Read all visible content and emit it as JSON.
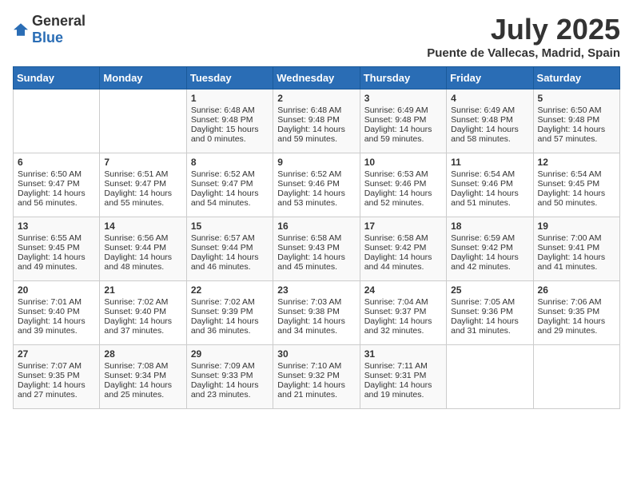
{
  "logo": {
    "general": "General",
    "blue": "Blue"
  },
  "header": {
    "month_year": "July 2025",
    "location": "Puente de Vallecas, Madrid, Spain"
  },
  "weekdays": [
    "Sunday",
    "Monday",
    "Tuesday",
    "Wednesday",
    "Thursday",
    "Friday",
    "Saturday"
  ],
  "weeks": [
    [
      {
        "day": "",
        "sunrise": "",
        "sunset": "",
        "daylight": ""
      },
      {
        "day": "",
        "sunrise": "",
        "sunset": "",
        "daylight": ""
      },
      {
        "day": "1",
        "sunrise": "Sunrise: 6:48 AM",
        "sunset": "Sunset: 9:48 PM",
        "daylight": "Daylight: 15 hours and 0 minutes."
      },
      {
        "day": "2",
        "sunrise": "Sunrise: 6:48 AM",
        "sunset": "Sunset: 9:48 PM",
        "daylight": "Daylight: 14 hours and 59 minutes."
      },
      {
        "day": "3",
        "sunrise": "Sunrise: 6:49 AM",
        "sunset": "Sunset: 9:48 PM",
        "daylight": "Daylight: 14 hours and 59 minutes."
      },
      {
        "day": "4",
        "sunrise": "Sunrise: 6:49 AM",
        "sunset": "Sunset: 9:48 PM",
        "daylight": "Daylight: 14 hours and 58 minutes."
      },
      {
        "day": "5",
        "sunrise": "Sunrise: 6:50 AM",
        "sunset": "Sunset: 9:48 PM",
        "daylight": "Daylight: 14 hours and 57 minutes."
      }
    ],
    [
      {
        "day": "6",
        "sunrise": "Sunrise: 6:50 AM",
        "sunset": "Sunset: 9:47 PM",
        "daylight": "Daylight: 14 hours and 56 minutes."
      },
      {
        "day": "7",
        "sunrise": "Sunrise: 6:51 AM",
        "sunset": "Sunset: 9:47 PM",
        "daylight": "Daylight: 14 hours and 55 minutes."
      },
      {
        "day": "8",
        "sunrise": "Sunrise: 6:52 AM",
        "sunset": "Sunset: 9:47 PM",
        "daylight": "Daylight: 14 hours and 54 minutes."
      },
      {
        "day": "9",
        "sunrise": "Sunrise: 6:52 AM",
        "sunset": "Sunset: 9:46 PM",
        "daylight": "Daylight: 14 hours and 53 minutes."
      },
      {
        "day": "10",
        "sunrise": "Sunrise: 6:53 AM",
        "sunset": "Sunset: 9:46 PM",
        "daylight": "Daylight: 14 hours and 52 minutes."
      },
      {
        "day": "11",
        "sunrise": "Sunrise: 6:54 AM",
        "sunset": "Sunset: 9:46 PM",
        "daylight": "Daylight: 14 hours and 51 minutes."
      },
      {
        "day": "12",
        "sunrise": "Sunrise: 6:54 AM",
        "sunset": "Sunset: 9:45 PM",
        "daylight": "Daylight: 14 hours and 50 minutes."
      }
    ],
    [
      {
        "day": "13",
        "sunrise": "Sunrise: 6:55 AM",
        "sunset": "Sunset: 9:45 PM",
        "daylight": "Daylight: 14 hours and 49 minutes."
      },
      {
        "day": "14",
        "sunrise": "Sunrise: 6:56 AM",
        "sunset": "Sunset: 9:44 PM",
        "daylight": "Daylight: 14 hours and 48 minutes."
      },
      {
        "day": "15",
        "sunrise": "Sunrise: 6:57 AM",
        "sunset": "Sunset: 9:44 PM",
        "daylight": "Daylight: 14 hours and 46 minutes."
      },
      {
        "day": "16",
        "sunrise": "Sunrise: 6:58 AM",
        "sunset": "Sunset: 9:43 PM",
        "daylight": "Daylight: 14 hours and 45 minutes."
      },
      {
        "day": "17",
        "sunrise": "Sunrise: 6:58 AM",
        "sunset": "Sunset: 9:42 PM",
        "daylight": "Daylight: 14 hours and 44 minutes."
      },
      {
        "day": "18",
        "sunrise": "Sunrise: 6:59 AM",
        "sunset": "Sunset: 9:42 PM",
        "daylight": "Daylight: 14 hours and 42 minutes."
      },
      {
        "day": "19",
        "sunrise": "Sunrise: 7:00 AM",
        "sunset": "Sunset: 9:41 PM",
        "daylight": "Daylight: 14 hours and 41 minutes."
      }
    ],
    [
      {
        "day": "20",
        "sunrise": "Sunrise: 7:01 AM",
        "sunset": "Sunset: 9:40 PM",
        "daylight": "Daylight: 14 hours and 39 minutes."
      },
      {
        "day": "21",
        "sunrise": "Sunrise: 7:02 AM",
        "sunset": "Sunset: 9:40 PM",
        "daylight": "Daylight: 14 hours and 37 minutes."
      },
      {
        "day": "22",
        "sunrise": "Sunrise: 7:02 AM",
        "sunset": "Sunset: 9:39 PM",
        "daylight": "Daylight: 14 hours and 36 minutes."
      },
      {
        "day": "23",
        "sunrise": "Sunrise: 7:03 AM",
        "sunset": "Sunset: 9:38 PM",
        "daylight": "Daylight: 14 hours and 34 minutes."
      },
      {
        "day": "24",
        "sunrise": "Sunrise: 7:04 AM",
        "sunset": "Sunset: 9:37 PM",
        "daylight": "Daylight: 14 hours and 32 minutes."
      },
      {
        "day": "25",
        "sunrise": "Sunrise: 7:05 AM",
        "sunset": "Sunset: 9:36 PM",
        "daylight": "Daylight: 14 hours and 31 minutes."
      },
      {
        "day": "26",
        "sunrise": "Sunrise: 7:06 AM",
        "sunset": "Sunset: 9:35 PM",
        "daylight": "Daylight: 14 hours and 29 minutes."
      }
    ],
    [
      {
        "day": "27",
        "sunrise": "Sunrise: 7:07 AM",
        "sunset": "Sunset: 9:35 PM",
        "daylight": "Daylight: 14 hours and 27 minutes."
      },
      {
        "day": "28",
        "sunrise": "Sunrise: 7:08 AM",
        "sunset": "Sunset: 9:34 PM",
        "daylight": "Daylight: 14 hours and 25 minutes."
      },
      {
        "day": "29",
        "sunrise": "Sunrise: 7:09 AM",
        "sunset": "Sunset: 9:33 PM",
        "daylight": "Daylight: 14 hours and 23 minutes."
      },
      {
        "day": "30",
        "sunrise": "Sunrise: 7:10 AM",
        "sunset": "Sunset: 9:32 PM",
        "daylight": "Daylight: 14 hours and 21 minutes."
      },
      {
        "day": "31",
        "sunrise": "Sunrise: 7:11 AM",
        "sunset": "Sunset: 9:31 PM",
        "daylight": "Daylight: 14 hours and 19 minutes."
      },
      {
        "day": "",
        "sunrise": "",
        "sunset": "",
        "daylight": ""
      },
      {
        "day": "",
        "sunrise": "",
        "sunset": "",
        "daylight": ""
      }
    ]
  ]
}
